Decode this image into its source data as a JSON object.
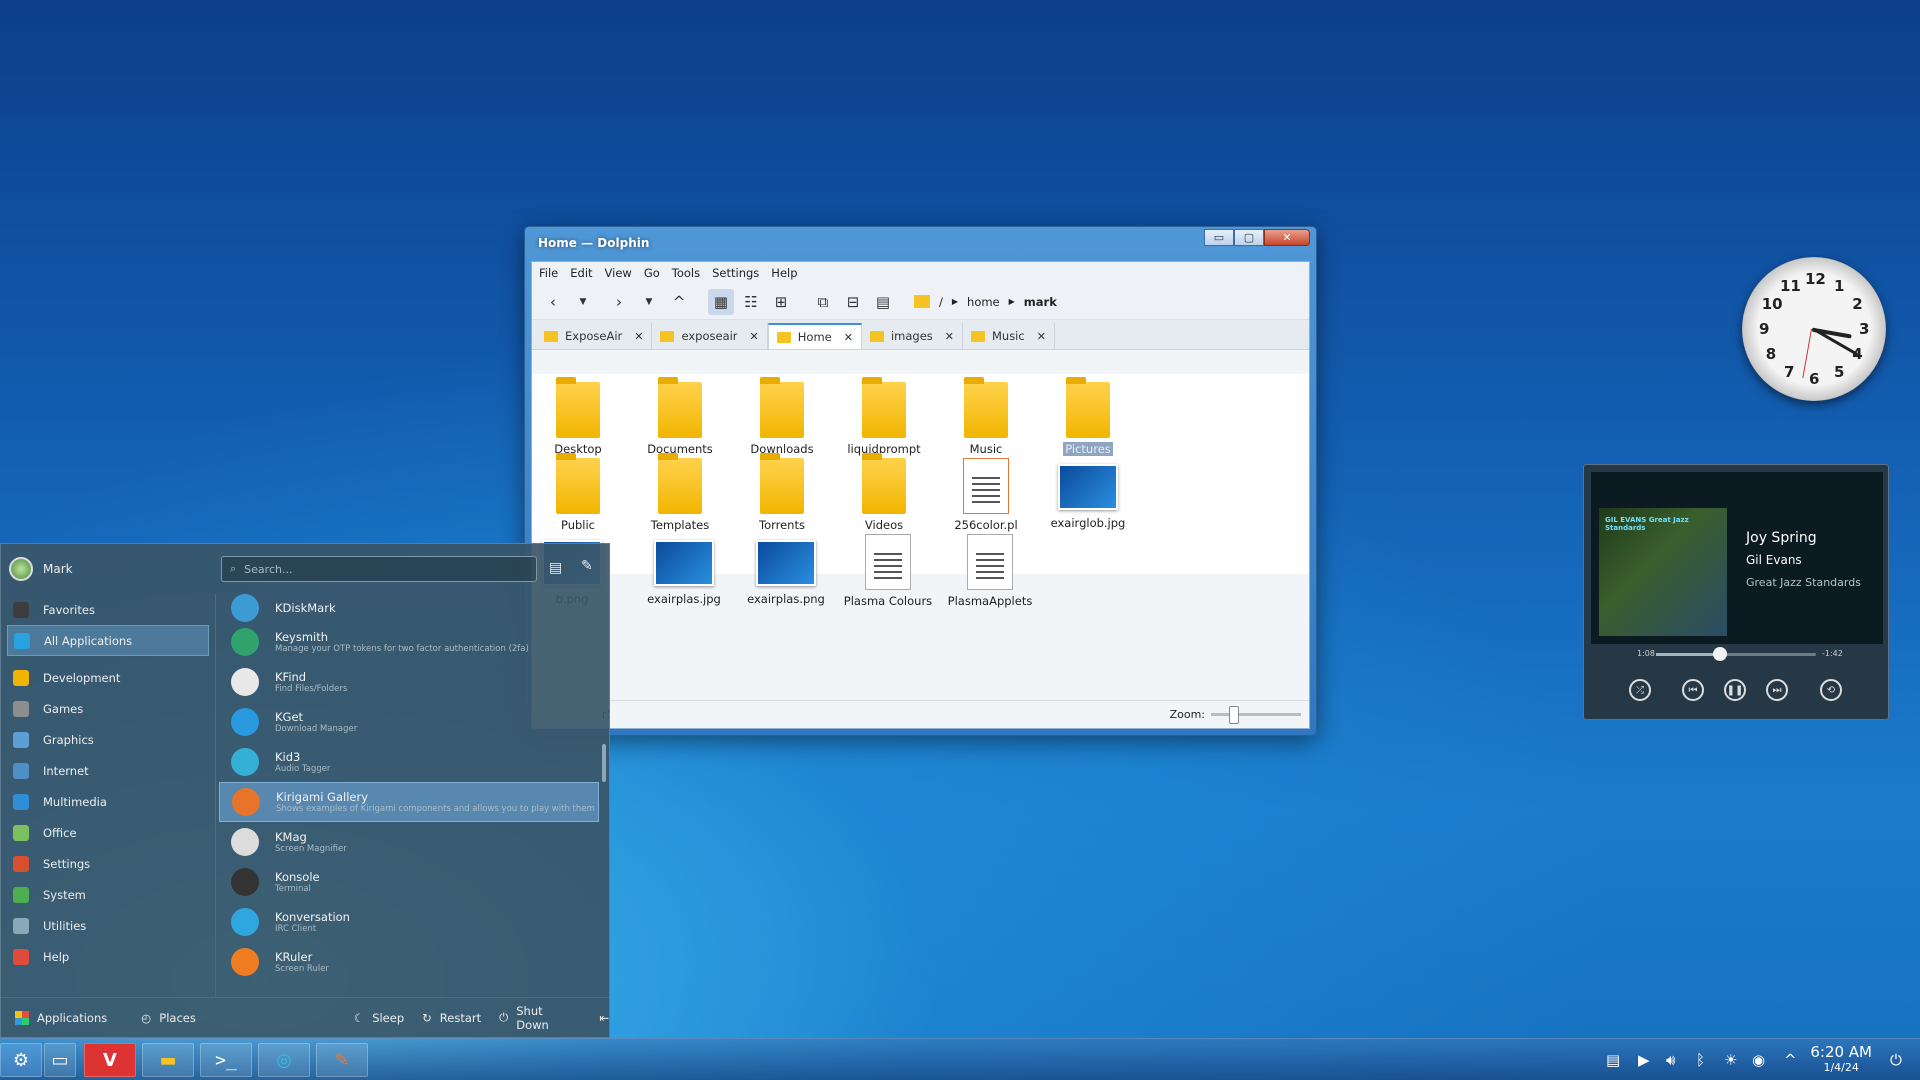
{
  "dolphin": {
    "title": "Home — Dolphin",
    "minimize": "▭",
    "maximize": "▢",
    "close": "✕",
    "menu": [
      "File",
      "Edit",
      "View",
      "Go",
      "Tools",
      "Settings",
      "Help"
    ],
    "toolbar_icons": [
      "back-icon",
      "dropdown-icon",
      "forward-icon",
      "dropdown-icon",
      "up-icon",
      "icons-view-icon",
      "compact-view-icon",
      "details-view-icon",
      "new-tab-icon",
      "split-icon",
      "preview-icon"
    ],
    "breadcrumb": {
      "root": "/",
      "home": "home",
      "current": "mark"
    },
    "tabs": [
      {
        "label": "ExposeAir",
        "active": false
      },
      {
        "label": "exposeair",
        "active": false
      },
      {
        "label": "Home",
        "active": true
      },
      {
        "label": "images",
        "active": false
      },
      {
        "label": "Music",
        "active": false
      }
    ],
    "files": [
      {
        "name": "Desktop",
        "type": "folder"
      },
      {
        "name": "Documents",
        "type": "folder"
      },
      {
        "name": "Downloads",
        "type": "folder"
      },
      {
        "name": "liquidprompt",
        "type": "folder"
      },
      {
        "name": "Music",
        "type": "folder"
      },
      {
        "name": "Pictures",
        "type": "folder",
        "selected": true
      },
      {
        "name": "Public",
        "type": "folder"
      },
      {
        "name": "Templates",
        "type": "folder"
      },
      {
        "name": "Torrents",
        "type": "folder"
      },
      {
        "name": "Videos",
        "type": "folder"
      },
      {
        "name": "256color.pl",
        "type": "script"
      },
      {
        "name": "exairglob.jpg",
        "type": "image"
      },
      {
        "name": "b.png",
        "type": "image"
      },
      {
        "name": "exairplas.jpg",
        "type": "image"
      },
      {
        "name": "exairplas.png",
        "type": "image"
      },
      {
        "name": "Plasma Colours",
        "type": "doc"
      },
      {
        "name": "PlasmaApplets",
        "type": "doc"
      }
    ],
    "status_text": "r)",
    "zoom_label": "Zoom:",
    "zoom_level": 0.25
  },
  "launcher": {
    "user": "Mark",
    "search_placeholder": "Search...",
    "categories": [
      {
        "label": "Favorites",
        "icon": "star-icon",
        "color": "#3d3d3d"
      },
      {
        "label": "All Applications",
        "icon": "apps-icon",
        "color": "#29a3e0",
        "selected": true
      },
      {
        "label": "Development",
        "icon": "development-icon",
        "color": "#f0b400"
      },
      {
        "label": "Games",
        "icon": "gamepad-icon",
        "color": "#8d8d8d"
      },
      {
        "label": "Graphics",
        "icon": "graphics-icon",
        "color": "#5c9fd6"
      },
      {
        "label": "Internet",
        "icon": "globe-icon",
        "color": "#4f8fc8"
      },
      {
        "label": "Multimedia",
        "icon": "multimedia-icon",
        "color": "#2e8ed6"
      },
      {
        "label": "Office",
        "icon": "office-icon",
        "color": "#7cbf5e"
      },
      {
        "label": "Settings",
        "icon": "settings-icon",
        "color": "#d64f2e"
      },
      {
        "label": "System",
        "icon": "system-icon",
        "color": "#4caf50"
      },
      {
        "label": "Utilities",
        "icon": "utilities-icon",
        "color": "#8aa9b8"
      },
      {
        "label": "Help",
        "icon": "help-icon",
        "color": "#e04a3b"
      }
    ],
    "apps": [
      {
        "name": "KDiskMark",
        "desc": "",
        "color": "#3d9bd4"
      },
      {
        "name": "Keysmith",
        "desc": "Manage your OTP tokens for two factor authentication (2fa)",
        "color": "#2fa36b"
      },
      {
        "name": "KFind",
        "desc": "Find Files/Folders",
        "color": "#e8e8e8"
      },
      {
        "name": "KGet",
        "desc": "Download Manager",
        "color": "#2a9ae0"
      },
      {
        "name": "Kid3",
        "desc": "Audio Tagger",
        "color": "#34b0d6"
      },
      {
        "name": "Kirigami Gallery",
        "desc": "Shows examples of Kirigami components and allows you to play with them",
        "color": "#e8742a",
        "selected": true
      },
      {
        "name": "KMag",
        "desc": "Screen Magnifier",
        "color": "#dcdcdc"
      },
      {
        "name": "Konsole",
        "desc": "Terminal",
        "color": "#333333"
      },
      {
        "name": "Konversation",
        "desc": "IRC Client",
        "color": "#2fa6e0"
      },
      {
        "name": "KRuler",
        "desc": "Screen Ruler",
        "color": "#f07d22"
      }
    ],
    "footer": {
      "applications": "Applications",
      "places": "Places",
      "sleep": "Sleep",
      "restart": "Restart",
      "shutdown": "Shut Down"
    }
  },
  "clock": {
    "numbers": [
      "12",
      "1",
      "2",
      "3",
      "4",
      "5",
      "6",
      "7",
      "8",
      "9",
      "10",
      "11"
    ]
  },
  "player": {
    "album_text": "GIL EVANS Great Jazz Standards",
    "track": "Joy Spring",
    "artist": "Gil Evans",
    "album": "Great Jazz Standards",
    "elapsed": "1:08",
    "remaining": "-1:42",
    "progress": 0.4
  },
  "taskbar": {
    "time": "6:20 AM",
    "date": "1/4/24",
    "apps": [
      "kde-menu-icon",
      "show-desktop-icon",
      "vivaldi-icon",
      "files-icon",
      "terminal-icon",
      "browser-icon",
      "krita-icon"
    ],
    "tray": [
      "clipboard-icon",
      "media-icon",
      "volume-icon",
      "bluetooth-icon",
      "brightness-icon",
      "network-icon",
      "expand-icon"
    ]
  }
}
